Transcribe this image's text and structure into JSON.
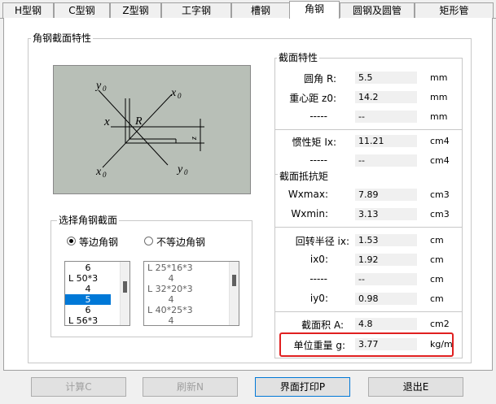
{
  "tabs": [
    {
      "label": "H型钢",
      "active": false
    },
    {
      "label": "C型钢",
      "active": false
    },
    {
      "label": "Z型钢",
      "active": false
    },
    {
      "label": "工字钢",
      "active": false
    },
    {
      "label": "槽钢",
      "active": false
    },
    {
      "label": "角钢",
      "active": true
    },
    {
      "label": "圆钢及圆管",
      "active": false
    },
    {
      "label": "矩形管",
      "active": false
    }
  ],
  "section_group_title": "角钢截面特性",
  "diagram": {
    "y0_top": "y",
    "y0_top_sub": "0",
    "x0_top": "x",
    "x0_top_sub": "0",
    "x_left": "x",
    "r": "R",
    "z0": "z",
    "z0_sub": "0",
    "x0_bottom": "x",
    "x0_bottom_sub": "0",
    "y0_bottom": "y",
    "y0_bottom_sub": "0"
  },
  "select_group": {
    "title": "选择角钢截面",
    "radio_equal": "等边角钢",
    "radio_unequal": "不等边角钢",
    "equal_list": [
      "6",
      "L 50*3",
      "4",
      "5",
      "6",
      "L 56*3"
    ],
    "equal_selected_index": 3,
    "unequal_list": [
      "L 25*16*3",
      "4",
      "L 32*20*3",
      "4",
      "L 40*25*3",
      "4"
    ]
  },
  "props": {
    "title": "截面特性",
    "r": {
      "label": "圆角   R:",
      "value": "5.5",
      "unit": "mm"
    },
    "z0": {
      "label": "重心距 z0:",
      "value": "14.2",
      "unit": "mm"
    },
    "blank1": {
      "label": "-----",
      "value": "--",
      "unit": "mm"
    },
    "ix": {
      "label": "惯性矩 Ix:",
      "value": "11.21",
      "unit": "cm4"
    },
    "blank2": {
      "label": "-----",
      "value": "--",
      "unit": "cm4"
    },
    "w_title": "截面抵抗矩",
    "wxmax": {
      "label": "Wxmax:",
      "value": "7.89",
      "unit": "cm3"
    },
    "wxmin": {
      "label": "Wxmin:",
      "value": "3.13",
      "unit": "cm3"
    },
    "rix": {
      "label": "回转半径 ix:",
      "value": "1.53",
      "unit": "cm"
    },
    "rix0": {
      "label": "ix0:",
      "value": "1.92",
      "unit": "cm"
    },
    "blank3": {
      "label": "-----",
      "value": "--",
      "unit": "cm"
    },
    "riy0": {
      "label": "iy0:",
      "value": "0.98",
      "unit": "cm"
    },
    "area": {
      "label": "截面积 A:",
      "value": "4.8",
      "unit": "cm2"
    },
    "weight": {
      "label": "单位重量 g:",
      "value": "3.77",
      "unit": "kg/m"
    }
  },
  "buttons": {
    "calc": "计算C",
    "refresh": "刷新N",
    "print": "界面打印P",
    "exit": "退出E"
  }
}
